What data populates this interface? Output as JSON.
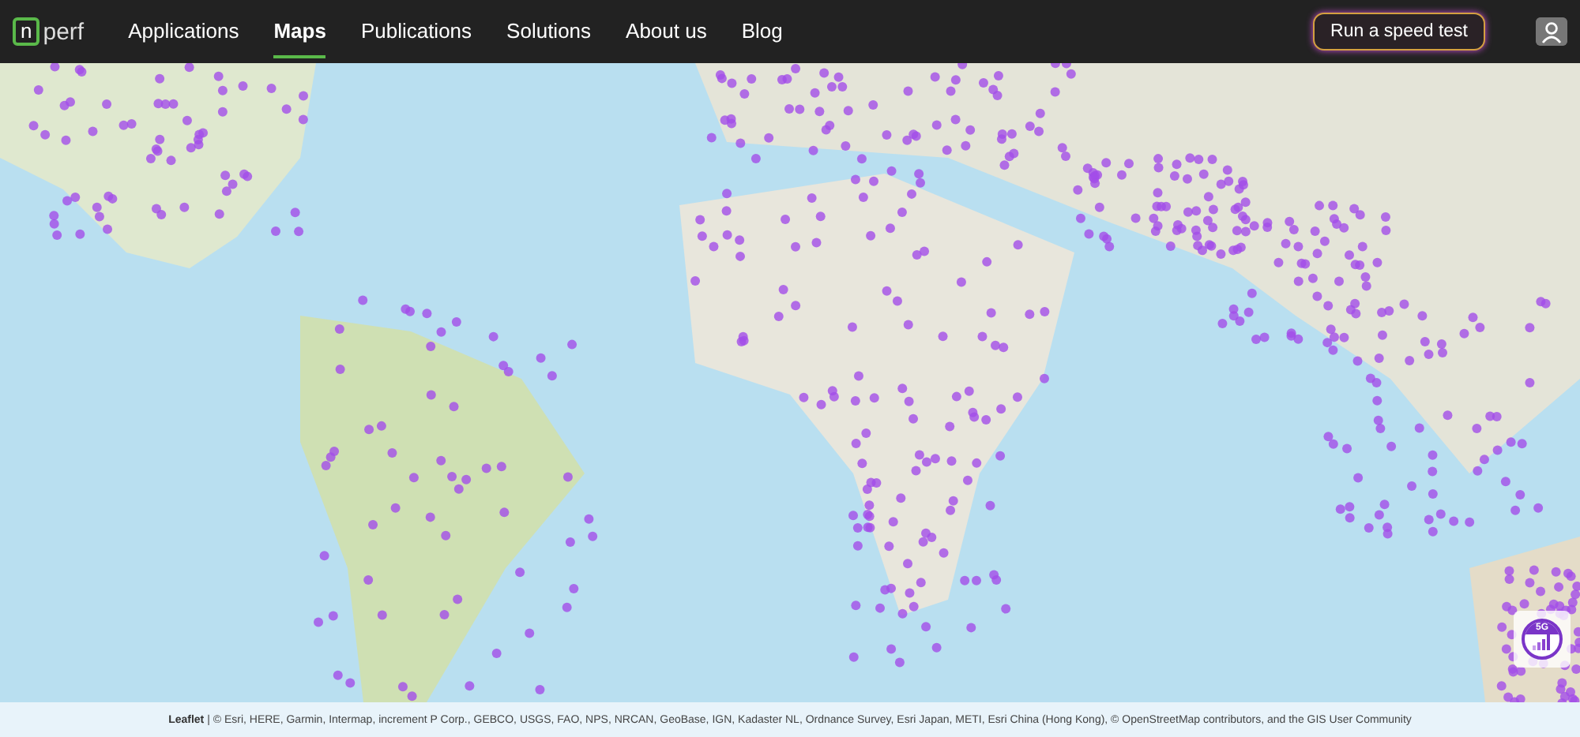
{
  "logo": {
    "mark": "n",
    "text": "perf"
  },
  "nav": [
    {
      "label": "Applications",
      "selected": false
    },
    {
      "label": "Maps",
      "selected": true
    },
    {
      "label": "Publications",
      "selected": false
    },
    {
      "label": "Solutions",
      "selected": false
    },
    {
      "label": "About us",
      "selected": false
    },
    {
      "label": "Blog",
      "selected": false
    }
  ],
  "speed_test_button": "Run a speed test",
  "network_badge": "5G",
  "attribution": {
    "link": "Leaflet",
    "text": "| © Esri, HERE, Garmin, Intermap, increment P Corp., GEBCO, USGS, FAO, NPS, NRCAN, GeoBase, IGN, Kadaster NL, Ordnance Survey, Esri Japan, METI, Esri China (Hong Kong), © OpenStreetMap contributors, and the GIS User Community"
  }
}
